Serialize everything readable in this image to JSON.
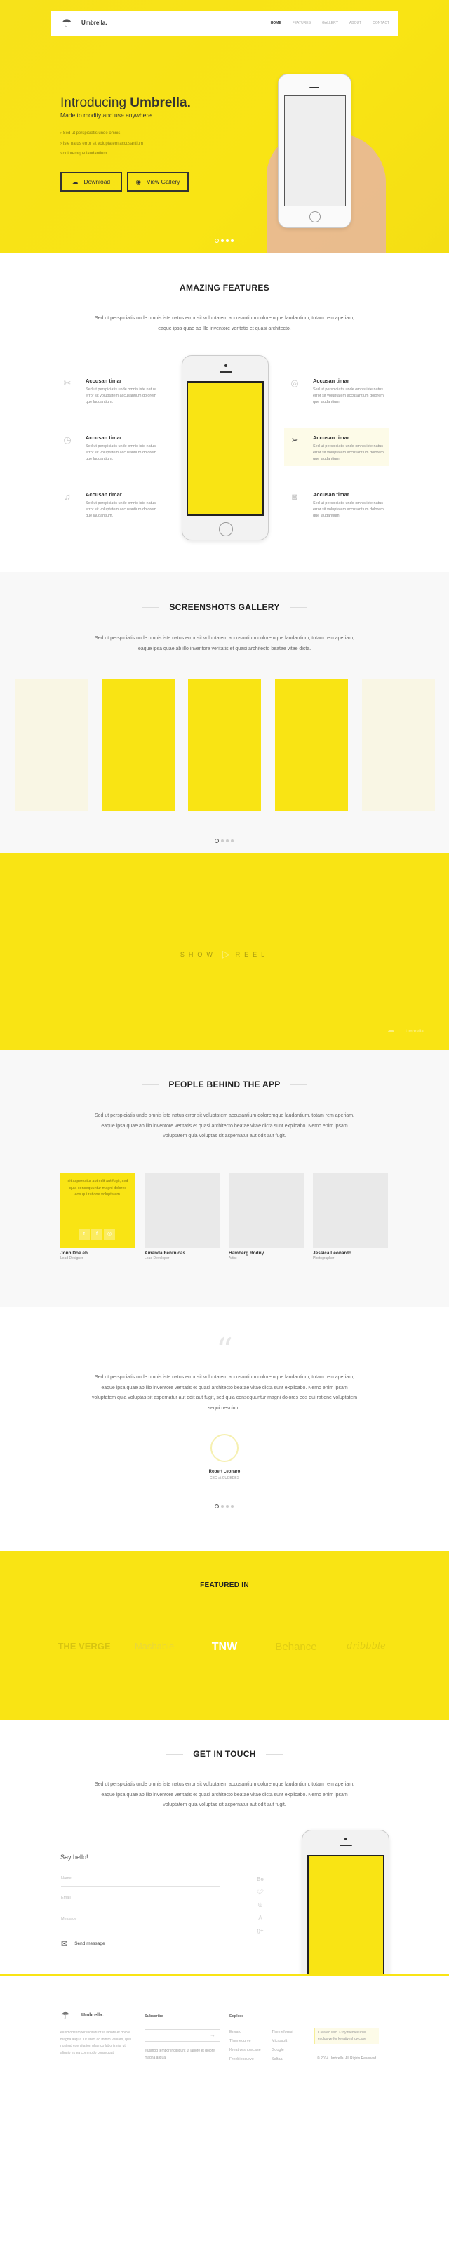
{
  "colors": {
    "brand_yellow": "#f9e414",
    "dark": "#222222"
  },
  "nav": {
    "brand": "Umbrella.",
    "items": [
      "HOME",
      "FEATURES",
      "GALLERY",
      "ABOUT",
      "CONTACT"
    ],
    "active": "HOME"
  },
  "hero": {
    "title_light": "Introducing",
    "title_bold": "Umbrella.",
    "subtitle": "Made to modify and use anywhere",
    "bullets": [
      "Sed ut perspiciatis unde omnis",
      "Iste natus error sit voluptatem accusantium",
      "doloremque laudantium"
    ],
    "download_label": "Download",
    "gallery_label": "View Gallery",
    "slides": 4,
    "active_slide": 1
  },
  "features": {
    "title": "AMAZING FEATURES",
    "desc": "Sed ut perspiciatis unde omnis iste natus error sit voluptatem accusantium doloremque laudantium, totam rem aperiam, eaque ipsa quae ab illo inventore veritatis et quasi architecto.",
    "items": [
      {
        "icon": "tools-icon",
        "title": "Accusan timar",
        "text": "Sed ut perspiciatis unde omnis iste natus error sit voluptatem accusantium dolorem que laudantium."
      },
      {
        "icon": "stopwatch-icon",
        "title": "Accusan timar",
        "text": "Sed ut perspiciatis unde omnis iste natus error sit voluptatem accusantium dolorem que laudantium."
      },
      {
        "icon": "music-icon",
        "title": "Accusan timar",
        "text": "Sed ut perspiciatis unde omnis iste natus error sit voluptatem accusantium dolorem que laudantium."
      },
      {
        "icon": "lightbulb-icon",
        "title": "Accusan timar",
        "text": "Sed ut perspiciatis unde omnis iste natus error sit voluptatem accusantium dolorem que laudantium."
      },
      {
        "icon": "paper-plane-icon",
        "title": "Accusan timar",
        "text": "Sed ut perspiciatis unde omnis iste natus error sit voluptatem accusantium dolorem que laudantium."
      },
      {
        "icon": "camera-icon",
        "title": "Accusan timar",
        "text": "Sed ut perspiciatis unde omnis iste natus error sit voluptatem accusantium dolorem que laudantium."
      }
    ]
  },
  "gallery": {
    "title": "SCREENSHOTS GALLERY",
    "desc": "Sed ut perspiciatis unde omnis iste natus error sit voluptatem accusantium doloremque laudantium, totam rem aperiam, eaque ipsa quae ab illo inventore veritatis et quasi architecto beatae vitae dicta.",
    "slides": 4,
    "active_slide": 1
  },
  "showreel": {
    "left": "SHOW",
    "right": "REEL",
    "brand": "Umbrella."
  },
  "team": {
    "title": "PEOPLE BEHIND THE APP",
    "desc": "Sed ut perspiciatis unde omnis iste natus error sit voluptatem accusantium doloremque laudantium, totam rem aperiam, eaque ipsa quae ab illo inventore veritatis et quasi architecto beatae vitae dicta sunt explicabo. Nemo enim ipsam voluptatem quia voluptas sit aspernatur aut odit aut fugit.",
    "hover_text": "sit aspernatur aut odit aut fugit, sed quia consequuntur magni dolores eos qui ratione voluptatem.",
    "members": [
      {
        "name": "Jonh Doe eh",
        "role": "Lead Designer"
      },
      {
        "name": "Amanda Fenrnicas",
        "role": "Lead Developer"
      },
      {
        "name": "Hamberg Rodny",
        "role": "Artist"
      },
      {
        "name": "Jessica Leonardo",
        "role": "Photographer"
      }
    ]
  },
  "testimonial": {
    "quote": "Sed ut perspiciatis unde omnis iste natus error sit voluptatem accusantium doloremque laudantium, totam rem aperiam, eaque ipsa quae ab illo inventore veritatis et quasi architecto beatae vitae dicta sunt explicabo. Nemo enim ipsam voluptatem quia voluptas sit aspernatur aut odit aut fugit, sed quia consequuntur magni dolores eos qui ratione voluptatem sequi nesciunt.",
    "name": "Robert Leonaro",
    "role": "CEO at CUBEDES",
    "slides": 4,
    "active_slide": 1
  },
  "featured": {
    "title": "FEATURED IN",
    "logos": [
      "THE VERGE",
      "Mashable",
      "TNW",
      "Behance",
      "dribbble"
    ]
  },
  "contact": {
    "title": "GET IN TOUCH",
    "desc": "Sed ut perspiciatis unde omnis iste natus error sit voluptatem accusantium doloremque laudantium, totam rem aperiam, eaque ipsa quae ab illo inventore veritatis et quasi architecto beatae vitae dicta sunt explicabo. Nemo enim ipsam voluptatem quia voluptas sit aspernatur aut odit aut fugit.",
    "heading": "Say hello!",
    "name_placeholder": "Name",
    "email_placeholder": "Email",
    "message_placeholder": "Message",
    "send_label": "Send message",
    "social": [
      "Be",
      "twitter",
      "dribbble",
      "A",
      "g+"
    ]
  },
  "footer": {
    "brand": "Umbrella.",
    "about": "eiusmod tempor incididunt ut labore et dolore magna aliqua. Ut enim ad minim veniam, quis nostrud exercitation ullamco laboris nisi ut aliquip ex ea commodo consequat.",
    "subscribe_title": "Subscribe",
    "subscribe_text": "eiusmod tempor incididunt ut labore et dolore magna aliqua.",
    "explore_title": "Explore",
    "explore_col1": [
      "Envato",
      "Themecurve",
      "Kreativeshowcase",
      "Freebiescurve"
    ],
    "explore_col2": [
      "Themeforest",
      "Microsoft",
      "Google",
      "Saltaa"
    ],
    "credit_pre": "Created with",
    "credit_post": "by themecurve, exclusive for kreativeshowcase",
    "copyright": "© 2014 Umbrella. All Rights Reserved."
  }
}
